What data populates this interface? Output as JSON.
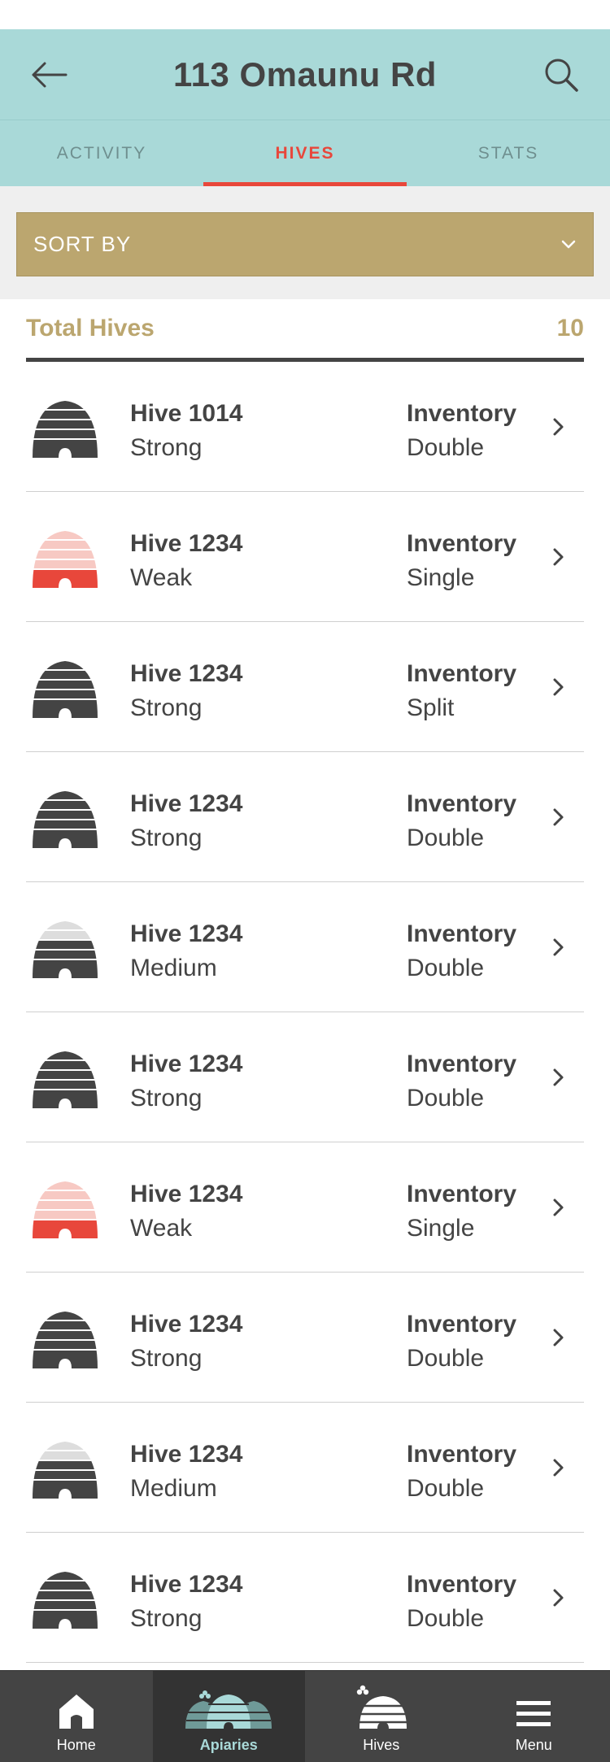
{
  "header": {
    "title": "113 Omaunu Rd"
  },
  "tabs": [
    {
      "label": "ACTIVITY",
      "active": false
    },
    {
      "label": "HIVES",
      "active": true
    },
    {
      "label": "STATS",
      "active": false
    }
  ],
  "sort": {
    "label": "SORT BY"
  },
  "summary": {
    "label": "Total Hives",
    "count": "10"
  },
  "hives": [
    {
      "name": "Hive 1014",
      "status": "Strong",
      "inventory_label": "Inventory",
      "type": "Double"
    },
    {
      "name": "Hive 1234",
      "status": "Weak",
      "inventory_label": "Inventory",
      "type": "Single"
    },
    {
      "name": "Hive 1234",
      "status": "Strong",
      "inventory_label": "Inventory",
      "type": "Split"
    },
    {
      "name": "Hive 1234",
      "status": "Strong",
      "inventory_label": "Inventory",
      "type": "Double"
    },
    {
      "name": "Hive 1234",
      "status": "Medium",
      "inventory_label": "Inventory",
      "type": "Double"
    },
    {
      "name": "Hive 1234",
      "status": "Strong",
      "inventory_label": "Inventory",
      "type": "Double"
    },
    {
      "name": "Hive 1234",
      "status": "Weak",
      "inventory_label": "Inventory",
      "type": "Single"
    },
    {
      "name": "Hive 1234",
      "status": "Strong",
      "inventory_label": "Inventory",
      "type": "Double"
    },
    {
      "name": "Hive 1234",
      "status": "Medium",
      "inventory_label": "Inventory",
      "type": "Double"
    },
    {
      "name": "Hive 1234",
      "status": "Strong",
      "inventory_label": "Inventory",
      "type": "Double"
    }
  ],
  "nav": [
    {
      "label": "Home",
      "icon": "home-icon",
      "active": false
    },
    {
      "label": "Apiaries",
      "icon": "apiaries-icon",
      "active": true
    },
    {
      "label": "Hives",
      "icon": "hives-icon",
      "active": false
    },
    {
      "label": "Menu",
      "icon": "menu-icon",
      "active": false
    }
  ],
  "colors": {
    "teal": "#a9d9d8",
    "accent_red": "#e8473b",
    "gold": "#bba66f",
    "dark": "#444444",
    "weak_light": "#f7c9c3",
    "medium_light": "#dddddd"
  }
}
